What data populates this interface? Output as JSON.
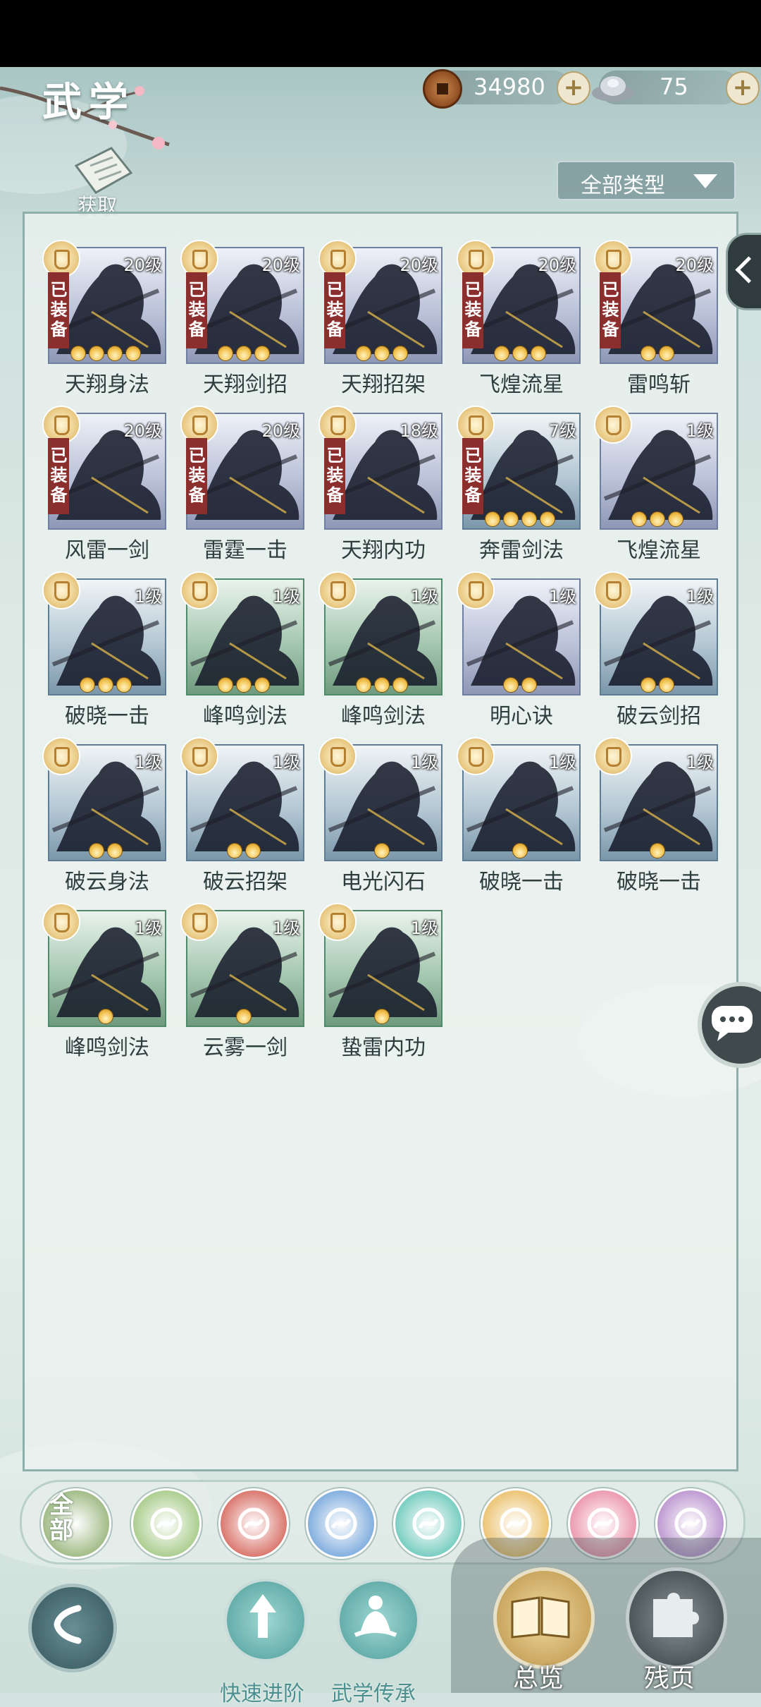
{
  "header": {
    "title": "武学",
    "copper": "34980",
    "silver": "75",
    "acquire_label": "获取",
    "filter_label": "全部类型"
  },
  "skills": [
    {
      "name": "天翔身法",
      "level": "20级",
      "equipped": true,
      "stars": 4,
      "tone": "purple"
    },
    {
      "name": "天翔剑招",
      "level": "20级",
      "equipped": true,
      "stars": 3,
      "tone": "purple"
    },
    {
      "name": "天翔招架",
      "level": "20级",
      "equipped": true,
      "stars": 3,
      "tone": "purple"
    },
    {
      "name": "飞煌流星",
      "level": "20级",
      "equipped": true,
      "stars": 3,
      "tone": "purple"
    },
    {
      "name": "雷鸣斩",
      "level": "20级",
      "equipped": true,
      "stars": 2,
      "tone": "purple"
    },
    {
      "name": "风雷一剑",
      "level": "20级",
      "equipped": true,
      "stars": 0,
      "tone": "purple"
    },
    {
      "name": "雷霆一击",
      "level": "20级",
      "equipped": true,
      "stars": 0,
      "tone": "purple"
    },
    {
      "name": "天翔内功",
      "level": "18级",
      "equipped": true,
      "stars": 0,
      "tone": "purple"
    },
    {
      "name": "奔雷剑法",
      "level": "7级",
      "equipped": true,
      "stars": 4,
      "tone": "blue"
    },
    {
      "name": "飞煌流星",
      "level": "1级",
      "equipped": false,
      "stars": 3,
      "tone": "purple"
    },
    {
      "name": "破晓一击",
      "level": "1级",
      "equipped": false,
      "stars": 3,
      "tone": "blue"
    },
    {
      "name": "峰鸣剑法",
      "level": "1级",
      "equipped": false,
      "stars": 3,
      "tone": "green"
    },
    {
      "name": "峰鸣剑法",
      "level": "1级",
      "equipped": false,
      "stars": 3,
      "tone": "green"
    },
    {
      "name": "明心诀",
      "level": "1级",
      "equipped": false,
      "stars": 2,
      "tone": "purple"
    },
    {
      "name": "破云剑招",
      "level": "1级",
      "equipped": false,
      "stars": 2,
      "tone": "blue"
    },
    {
      "name": "破云身法",
      "level": "1级",
      "equipped": false,
      "stars": 2,
      "tone": "blue"
    },
    {
      "name": "破云招架",
      "level": "1级",
      "equipped": false,
      "stars": 2,
      "tone": "blue"
    },
    {
      "name": "电光闪石",
      "level": "1级",
      "equipped": false,
      "stars": 1,
      "tone": "blue"
    },
    {
      "name": "破晓一击",
      "level": "1级",
      "equipped": false,
      "stars": 1,
      "tone": "blue"
    },
    {
      "name": "破晓一击",
      "level": "1级",
      "equipped": false,
      "stars": 1,
      "tone": "blue"
    },
    {
      "name": "峰鸣剑法",
      "level": "1级",
      "equipped": false,
      "stars": 1,
      "tone": "green"
    },
    {
      "name": "云雾一剑",
      "level": "1级",
      "equipped": false,
      "stars": 1,
      "tone": "green"
    },
    {
      "name": "蛰雷内功",
      "level": "1级",
      "equipped": false,
      "stars": 1,
      "tone": "green"
    }
  ],
  "equipped_tag": "已装备",
  "category_tabs": {
    "all_label": "全部",
    "items": [
      {
        "icon": "all-icon",
        "color": "#8fae6f"
      },
      {
        "icon": "arrows-icon",
        "color": "#9cc47a"
      },
      {
        "icon": "flame-icon",
        "color": "#d25d52"
      },
      {
        "icon": "wave-icon",
        "color": "#6b9fd8"
      },
      {
        "icon": "butterfly-icon",
        "color": "#5fc4b5"
      },
      {
        "icon": "shield-icon",
        "color": "#e8b95a"
      },
      {
        "icon": "moon-icon",
        "color": "#e886a0"
      },
      {
        "icon": "rose-icon",
        "color": "#b186c8"
      }
    ]
  },
  "footer": {
    "quick_advance": "快速进阶",
    "inheritance": "武学传承",
    "overview": "总览",
    "fragments": "残页"
  }
}
